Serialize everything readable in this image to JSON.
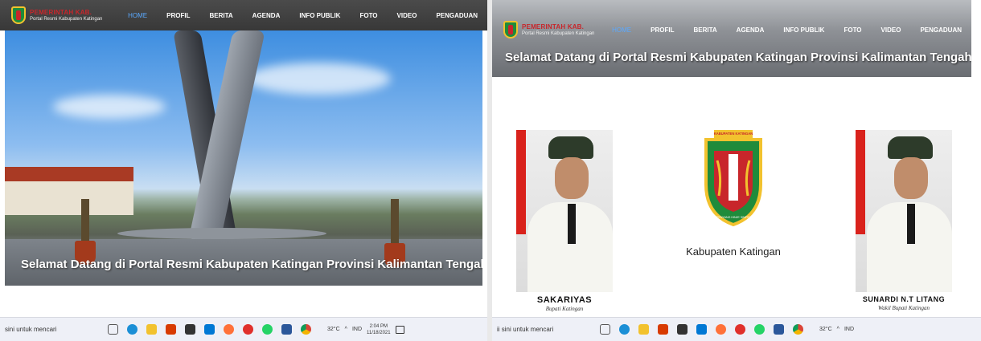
{
  "left": {
    "logo": {
      "line1": "",
      "line2": "Portal Resmi Kabupaten Katingan"
    },
    "menu": [
      "HOME",
      "PROFIL",
      "BERITA",
      "AGENDA",
      "INFO PUBLIK",
      "FOTO",
      "VIDEO",
      "PENGADUAN"
    ],
    "active_menu": "HOME",
    "hero_caption": "Selamat Datang di Portal Resmi Kabupaten Katingan Provinsi Kalimantan Tengah",
    "taskbar": {
      "search": "sini untuk mencari",
      "temperature": "32°C",
      "language": "IND",
      "time": "2:04 PM",
      "date": "11/18/2021"
    }
  },
  "right": {
    "logo": {
      "line2": "Portal Resmi Kabupaten Katingan"
    },
    "menu": [
      "HOME",
      "PROFIL",
      "BERITA",
      "AGENDA",
      "INFO PUBLIK",
      "FOTO",
      "VIDEO",
      "PENGADUAN"
    ],
    "banner_caption": "Selamat Datang di Portal Resmi Kabupaten Katingan Provinsi Kalimantan Tengah",
    "regent": {
      "name": "SAKARIYAS",
      "title": "Bupati Katingan"
    },
    "region_label": "Kabupaten Katingan",
    "emblem_text": {
      "top": "KABUPATEN KATINGAN",
      "bottom": "PENYANG HINJE SIMPEI"
    },
    "vice_regent": {
      "name": "SUNARDI N.T LITANG",
      "title": "Wakil Bupati Katingan"
    },
    "taskbar": {
      "search": "ii sini untuk mencari",
      "temperature": "32°C",
      "language": "IND"
    }
  },
  "colors": {
    "nav": "#3f3f3f",
    "active": "#5aa9ff",
    "emblem_green": "#1f8b3b",
    "emblem_yellow": "#f2c22e",
    "emblem_red": "#c8262b"
  },
  "taskbar_icons": [
    "task-view-icon",
    "edge-icon",
    "file-explorer-icon",
    "office-icon",
    "store-icon",
    "mail-icon",
    "firefox-icon",
    "app-icon",
    "whatsapp-icon",
    "word-icon",
    "chrome-icon"
  ]
}
